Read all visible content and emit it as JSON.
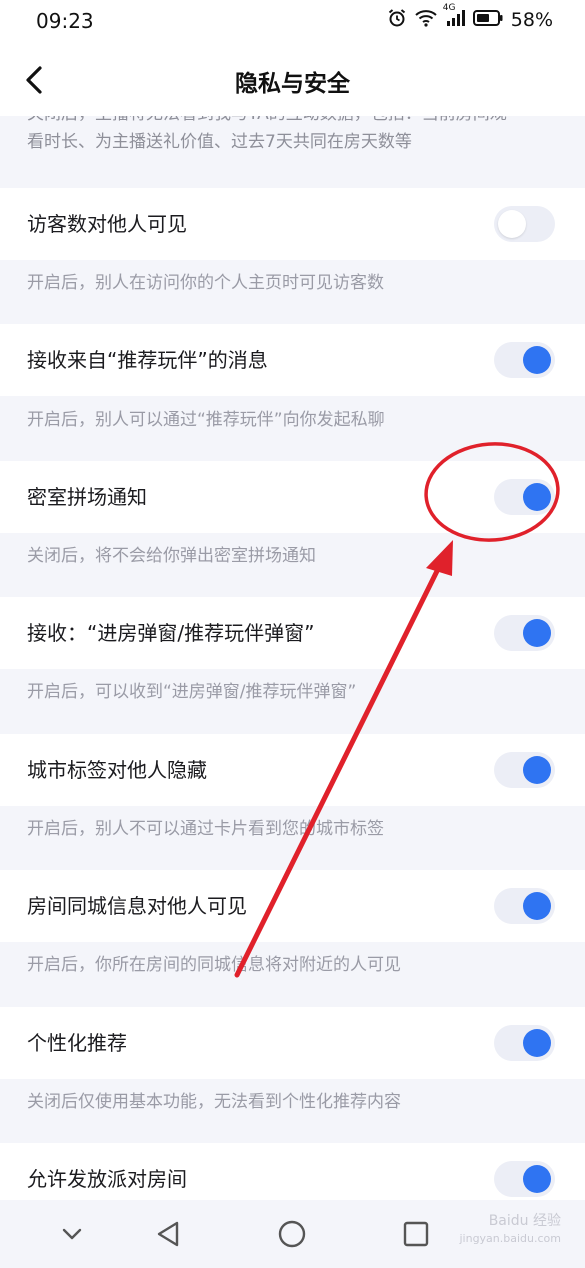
{
  "status_bar": {
    "time": "09:23",
    "network": "4G",
    "battery": "58%"
  },
  "header": {
    "title": "隐私与安全"
  },
  "top_desc": {
    "line1": "关闭后，主播将无法看到我与TA的互动数据，包括：当前房间观",
    "line2": "看时长、为主播送礼价值、过去7天共同在房天数等"
  },
  "settings": [
    {
      "label": "访客数对他人可见",
      "on": false,
      "desc": "开启后，别人在访问你的个人主页时可见访客数"
    },
    {
      "label": "接收来自“推荐玩伴”的消息",
      "on": true,
      "desc": "开启后，别人可以通过“推荐玩伴”向你发起私聊"
    },
    {
      "label": "密室拼场通知",
      "on": true,
      "desc": "关闭后，将不会给你弹出密室拼场通知"
    },
    {
      "label": "接收：“进房弹窗/推荐玩伴弹窗”",
      "on": true,
      "desc": "开启后，可以收到“进房弹窗/推荐玩伴弹窗”"
    },
    {
      "label": "城市标签对他人隐藏",
      "on": true,
      "desc": "开启后，别人不可以通过卡片看到您的城市标签"
    },
    {
      "label": "房间同城信息对他人可见",
      "on": true,
      "desc": "开启后，你所在房间的同城信息将对附近的人可见"
    },
    {
      "label": "个性化推荐",
      "on": true,
      "desc": "关闭后仅使用基本功能，无法看到个性化推荐内容"
    },
    {
      "label": "允许发放派对房间",
      "on": true,
      "desc": ""
    }
  ],
  "watermark": {
    "line1": "Baidu 经验",
    "line2": "jingyan.baidu.com"
  },
  "colors": {
    "accent": "#2f74f2",
    "annotation": "#e0212b"
  }
}
